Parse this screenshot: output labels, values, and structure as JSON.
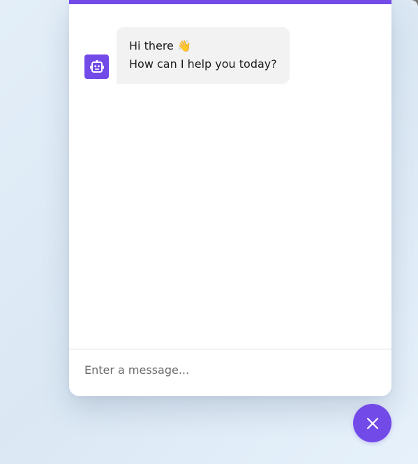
{
  "colors": {
    "accent": "#724ae8",
    "bubble_bg": "#f2f2f2",
    "window_bg": "#ffffff"
  },
  "chat": {
    "messages": [
      {
        "role": "bot",
        "avatar_icon": "robot-icon",
        "lines": [
          "Hi there 👋",
          "How can I help you today?"
        ]
      }
    ]
  },
  "input": {
    "placeholder": "Enter a message...",
    "value": ""
  },
  "toggler": {
    "icon": "close-icon"
  }
}
